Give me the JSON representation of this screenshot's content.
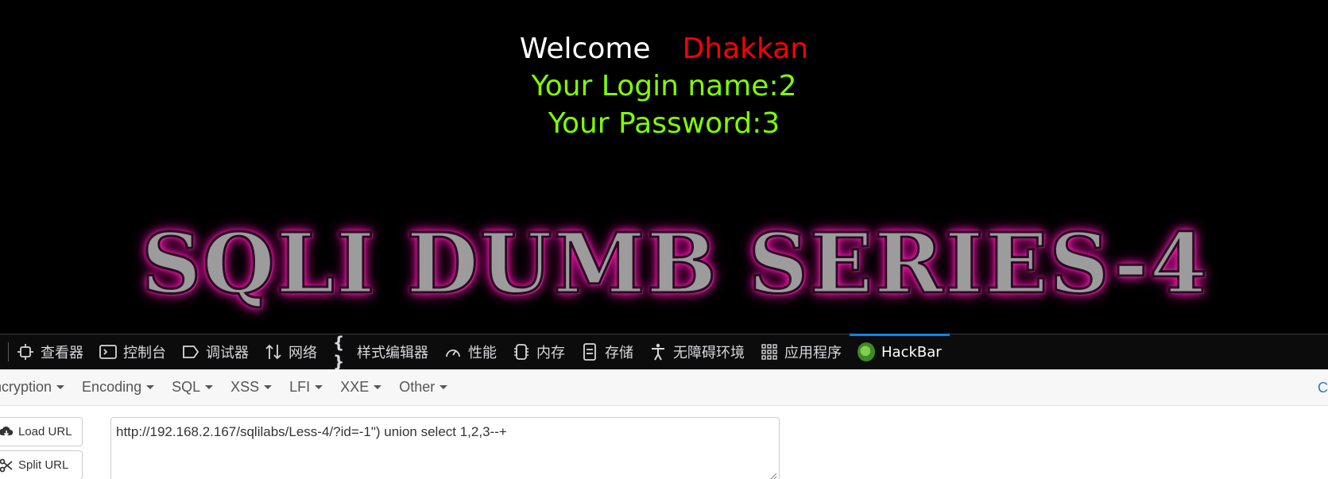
{
  "page": {
    "welcome_word": "Welcome",
    "user_name": "Dhakkan",
    "login_line": "Your Login name:2",
    "password_line": "Your Password:3",
    "banner_text": "SQLI DUMB SERIES-4"
  },
  "devtools": {
    "tabs": [
      {
        "label": "查看器",
        "icon": "inspector-icon"
      },
      {
        "label": "控制台",
        "icon": "console-icon"
      },
      {
        "label": "调试器",
        "icon": "debugger-icon"
      },
      {
        "label": "网络",
        "icon": "network-icon"
      },
      {
        "label": "样式编辑器",
        "icon": "style-editor-icon"
      },
      {
        "label": "性能",
        "icon": "performance-icon"
      },
      {
        "label": "内存",
        "icon": "memory-icon"
      },
      {
        "label": "存储",
        "icon": "storage-icon"
      },
      {
        "label": "无障碍环境",
        "icon": "accessibility-icon"
      },
      {
        "label": "应用程序",
        "icon": "application-icon"
      },
      {
        "label": "HackBar",
        "icon": "hackbar-logo-icon",
        "active": true
      }
    ]
  },
  "hackbar": {
    "menu": [
      "ncryption",
      "Encoding",
      "SQL",
      "XSS",
      "LFI",
      "XXE",
      "Other"
    ],
    "right_link": "Co",
    "load_url_label": "Load URL",
    "split_url_label": "Split URL",
    "url_value": "http://192.168.2.167/sqlilabs/Less-4/?id=-1\") union select 1,2,3--+"
  },
  "colors": {
    "background": "#000000",
    "welcome": "#ffffff",
    "user_name": "#ff0000",
    "info_text": "#80ff00",
    "banner_glow": "#ff1fb4",
    "active_tab_indicator": "#0a84ff",
    "link": "#337ab7"
  }
}
